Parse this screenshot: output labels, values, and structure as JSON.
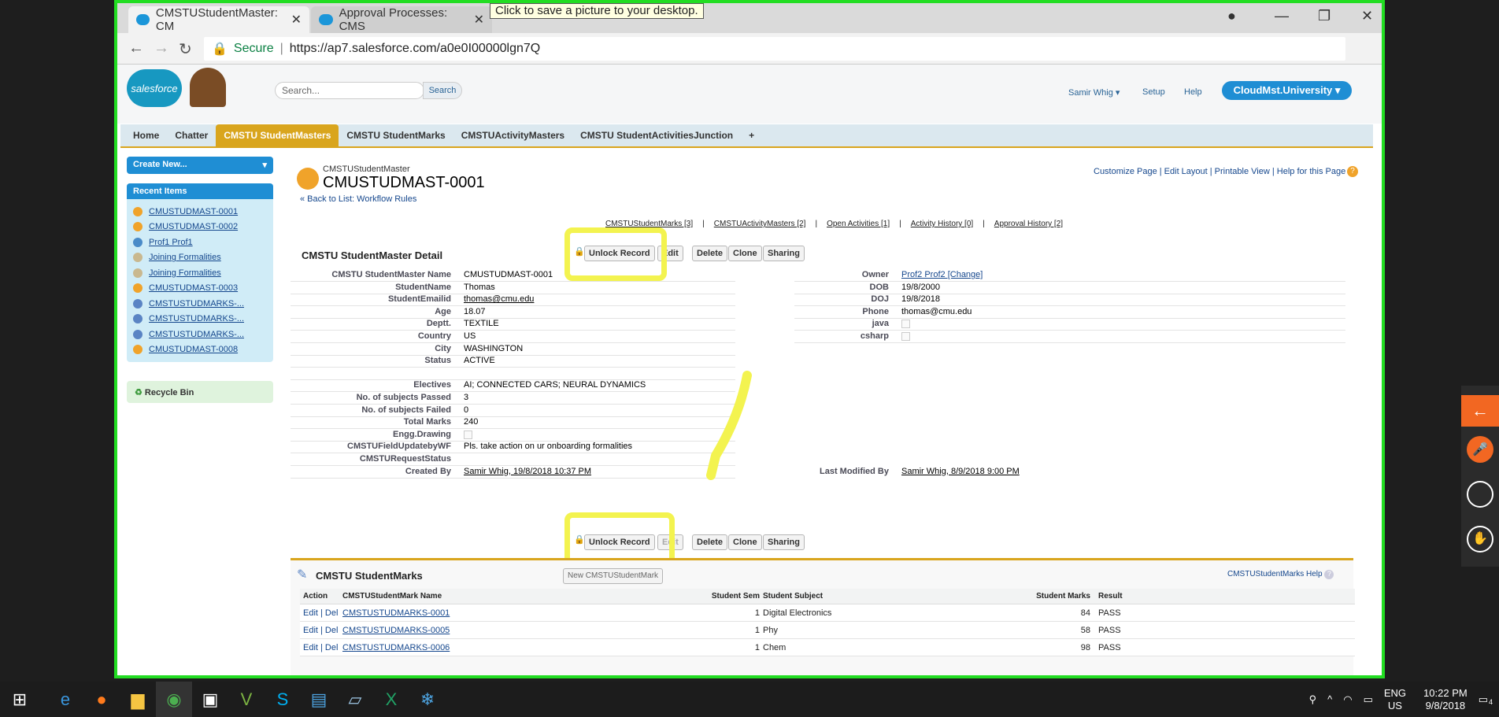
{
  "browser": {
    "tabs": [
      {
        "title": "CMSTUStudentMaster: CM"
      },
      {
        "title": "Approval Processes: CMS"
      }
    ],
    "tooltip": "Click to save a picture to your desktop.",
    "secure_label": "Secure",
    "url": "https://ap7.salesforce.com/a0e0I00000lgn7Q"
  },
  "sf": {
    "logo": "salesforce",
    "search_placeholder": "Search...",
    "search_button": "Search",
    "user": "Samir Whig",
    "setup": "Setup",
    "help": "Help",
    "org": "CloudMst.University",
    "tabs": [
      "Home",
      "Chatter",
      "CMSTU StudentMasters",
      "CMSTU StudentMarks",
      "CMSTUActivityMasters",
      "CMSTU StudentActivitiesJunction",
      "+"
    ],
    "create_new": "Create New...",
    "recent_title": "Recent Items",
    "recent_items": [
      "CMUSTUDMAST-0001",
      "CMUSTUDMAST-0002",
      "Prof1 Prof1",
      "Joining Formalities",
      "Joining Formalities",
      "CMUSTUDMAST-0003",
      "CMSTUSTUDMARKS-...",
      "CMSTUSTUDMARKS-...",
      "CMSTUSTUDMARKS-...",
      "CMUSTUDMAST-0008"
    ],
    "recycle": "Recycle Bin"
  },
  "record": {
    "object": "CMSTUStudentMaster",
    "name": "CMUSTUDMAST-0001",
    "back": "« Back to List: Workflow Rules",
    "page_links": "Customize Page | Edit Layout | Printable View | Help for this Page",
    "related_links": [
      "CMSTUStudentMarks [3]",
      "CMSTUActivityMasters [2]",
      "Open Activities [1]",
      "Activity History [0]",
      "Approval History [2]"
    ],
    "detail_title": "CMSTU StudentMaster Detail",
    "buttons": [
      "Unlock Record",
      "Edit",
      "Delete",
      "Clone",
      "Sharing"
    ],
    "left_labels": [
      "CMSTU StudentMaster Name",
      "StudentName",
      "StudentEmailid",
      "Age",
      "Deptt.",
      "Country",
      "City",
      "Status",
      "",
      "Electives",
      "No. of subjects Passed",
      "No. of subjects Failed",
      "Total Marks",
      "Engg.Drawing",
      "CMSTUFieldUpdatebyWF",
      "CMSTURequestStatus",
      "Created By"
    ],
    "left_values": [
      "CMUSTUDMAST-0001",
      "Thomas",
      "thomas@cmu.edu",
      "18.07",
      "TEXTILE",
      "US",
      "WASHINGTON",
      "ACTIVE",
      "",
      "AI; CONNECTED CARS; NEURAL DYNAMICS",
      "3",
      "0",
      "240",
      "",
      "Pls. take action on ur onboarding formalities",
      "",
      "Samir Whig, 19/8/2018 10:37 PM"
    ],
    "right_labels": [
      "Owner",
      "DOB",
      "DOJ",
      "Phone",
      "java",
      "csharp"
    ],
    "right_values": [
      "Prof2 Prof2 [Change]",
      "19/8/2000",
      "19/8/2018",
      "thomas@cmu.edu",
      "",
      ""
    ],
    "last_modified_label": "Last Modified By",
    "last_modified_value": "Samir Whig, 8/9/2018 9:00 PM"
  },
  "marks": {
    "title": "CMSTU StudentMarks",
    "new_button": "New CMSTUStudentMark",
    "help": "CMSTUStudentMarks Help",
    "columns": [
      "Action",
      "CMSTUStudentMark Name",
      "Student Sem",
      "Student Subject",
      "Student Marks",
      "Result"
    ],
    "rows": [
      {
        "action": "Edit | Del",
        "name": "CMSTUSTUDMARKS-0001",
        "sem": "1",
        "subject": "Digital Electronics",
        "marks": "84",
        "result": "PASS"
      },
      {
        "action": "Edit | Del",
        "name": "CMSTUSTUDMARKS-0005",
        "sem": "1",
        "subject": "Phy",
        "marks": "58",
        "result": "PASS"
      },
      {
        "action": "Edit | Del",
        "name": "CMSTUSTUDMARKS-0006",
        "sem": "1",
        "subject": "Chem",
        "marks": "98",
        "result": "PASS"
      }
    ]
  },
  "taskbar": {
    "lang": "ENG",
    "region": "US",
    "time": "10:22 PM",
    "date": "9/8/2018",
    "notif": "4"
  }
}
